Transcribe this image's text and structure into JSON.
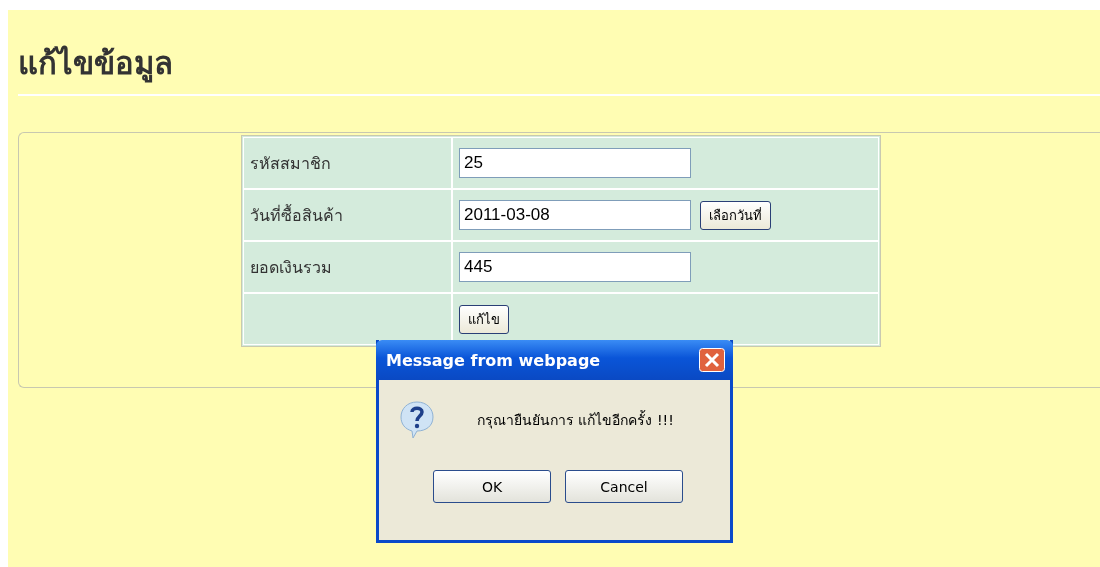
{
  "page_title": "แก้ไขข้อมูล",
  "form": {
    "rows": [
      {
        "kind": "input",
        "label": "รหัสสมาชิก",
        "value": "25"
      },
      {
        "kind": "date",
        "label": "วันที่ซื้อสินค้า",
        "value": "2011-03-08",
        "button": "เลือกวันที่"
      },
      {
        "kind": "input",
        "label": "ยอดเงินรวม",
        "value": "445"
      },
      {
        "kind": "submit",
        "button": "แก้ไข"
      }
    ]
  },
  "dialog": {
    "title": "Message from webpage",
    "message": "กรุณายืนยันการ แก้ไขอีกครั้ง !!!",
    "buttons": [
      "OK",
      "Cancel"
    ]
  }
}
